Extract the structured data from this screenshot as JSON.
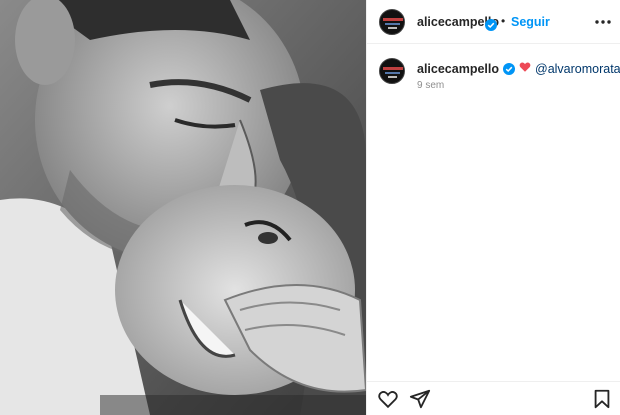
{
  "post": {
    "author": "alicecampello",
    "follow_label": "Seguir",
    "separator": "•",
    "caption_mention": "@alvaromorata",
    "caption_emoji": "heart-emoji",
    "time_ago": "9 sem"
  },
  "photo": {
    "style": "black-and-white",
    "description_icon": "post-photo"
  },
  "icons": {
    "verified": "verified-badge-icon",
    "more": "more-options-icon",
    "like": "heart-outline-icon",
    "share": "paper-plane-icon",
    "save": "bookmark-icon"
  },
  "colors": {
    "link_blue": "#0095f6",
    "verified_blue": "#0095f6",
    "mention": "#00376b",
    "heart_red": "#ed4956",
    "muted": "#8e8e8e"
  }
}
